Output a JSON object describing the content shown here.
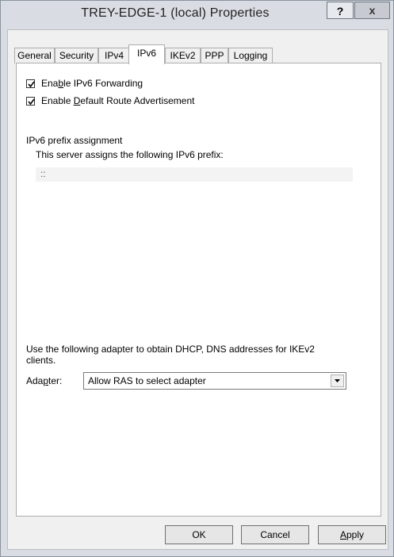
{
  "window": {
    "title": "TREY-EDGE-1 (local) Properties",
    "help_label": "?",
    "close_label": "x"
  },
  "tabs": [
    {
      "label": "General",
      "active": false
    },
    {
      "label": "Security",
      "active": false
    },
    {
      "label": "IPv4",
      "active": false
    },
    {
      "label": "IPv6",
      "active": true
    },
    {
      "label": "IKEv2",
      "active": false
    },
    {
      "label": "PPP",
      "active": false
    },
    {
      "label": "Logging",
      "active": false
    }
  ],
  "ipv6": {
    "forwarding": {
      "pre": "Ena",
      "key": "b",
      "post": "le IPv6 Forwarding",
      "checked": true
    },
    "default_route": {
      "pre": "Enable ",
      "key": "D",
      "post": "efault Route Advertisement",
      "checked": true
    },
    "prefix_heading": "IPv6 prefix assignment",
    "prefix_desc": "This server assigns the following  IPv6 prefix:",
    "prefix_value": "::",
    "adapter_note_line1": "Use the following adapter to obtain DHCP, DNS addresses for IKEv2",
    "adapter_note_line2": "clients.",
    "adapter_label_pre": "Ada",
    "adapter_label_key": "p",
    "adapter_label_post": "ter:",
    "adapter_value": "Allow RAS to select adapter"
  },
  "buttons": {
    "ok": "OK",
    "cancel": "Cancel",
    "apply_key": "A",
    "apply_rest": "pply"
  },
  "colors": {
    "frame": "#d9dde3",
    "dialog": "#f0f0f0",
    "panel": "#ffffff"
  }
}
